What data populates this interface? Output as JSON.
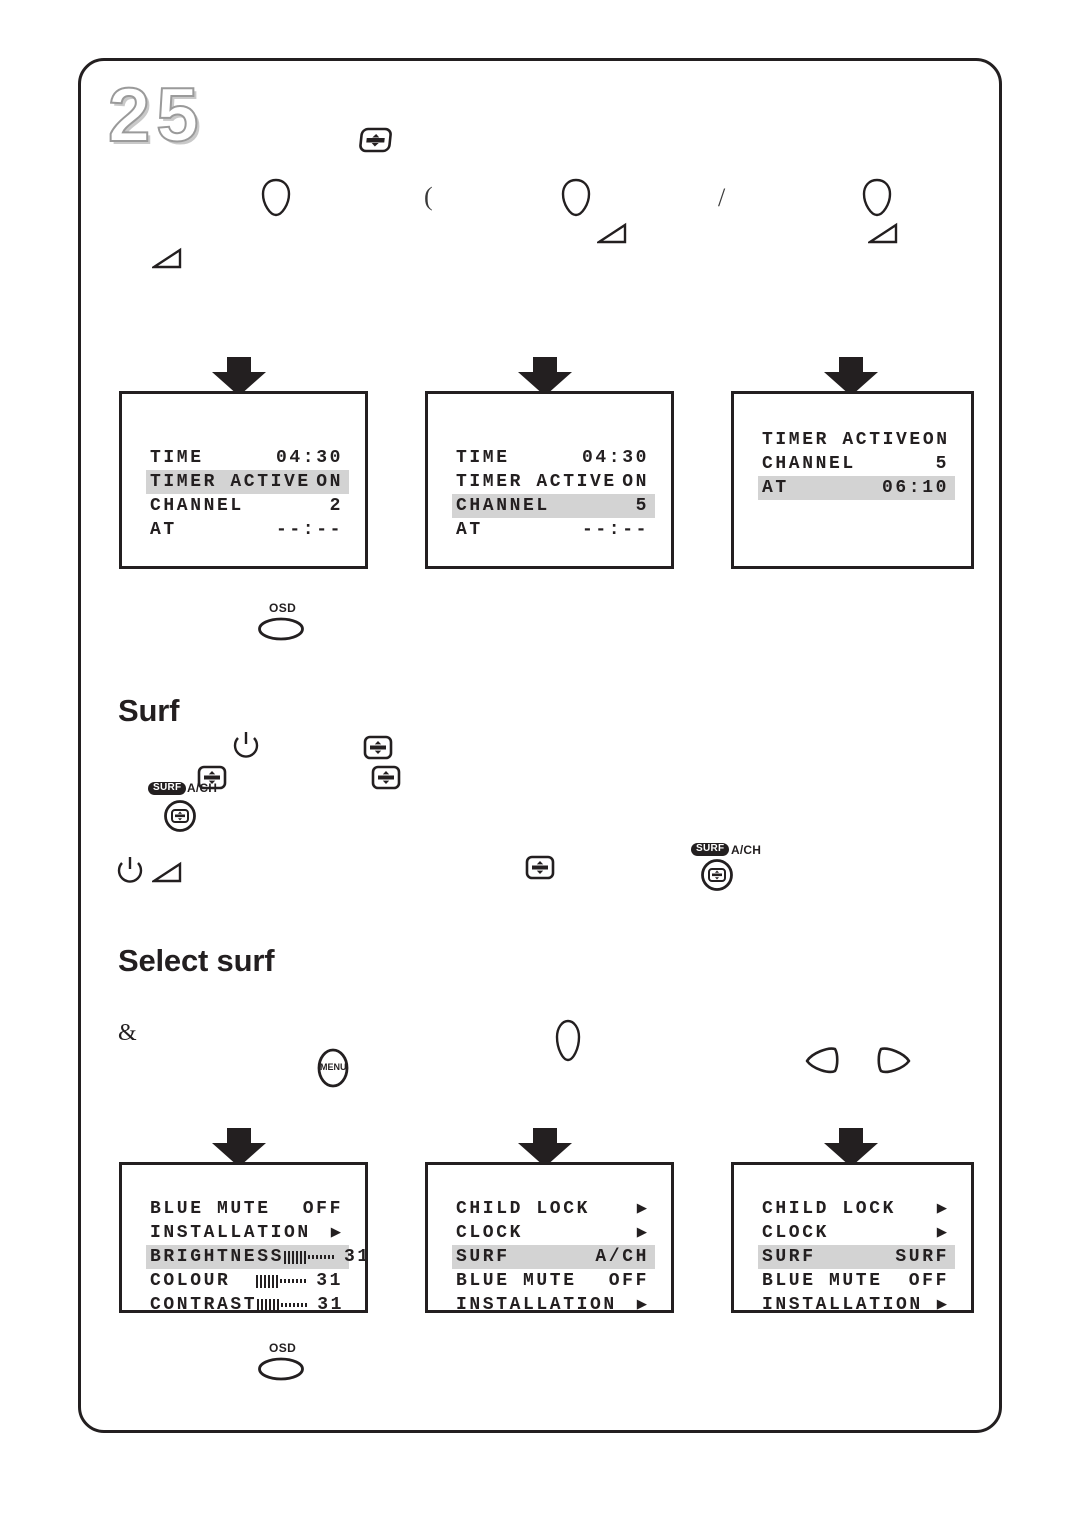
{
  "page": {
    "number": "25",
    "frame_color": "#231f20"
  },
  "headings": {
    "surf": "Surf",
    "select_surf": "Select surf"
  },
  "symbols": {
    "ampersand": "&",
    "slash": "/",
    "paren": "("
  },
  "buttons": {
    "osd_label": "OSD",
    "menu_label": "MENU",
    "surf_badge": "SURF",
    "ach_label": "A/CH"
  },
  "osd_screens": [
    {
      "id": "timer-screen-1",
      "rows": [
        {
          "label": "TIME",
          "value": "04:30",
          "highlight": false,
          "kind": "value"
        },
        {
          "label": "TIMER ACTIVE",
          "value": "ON",
          "highlight": true,
          "kind": "value"
        },
        {
          "label": "CHANNEL",
          "value": "2",
          "highlight": false,
          "kind": "value"
        },
        {
          "label": "AT",
          "value": "--:--",
          "highlight": false,
          "kind": "value"
        }
      ]
    },
    {
      "id": "timer-screen-2",
      "rows": [
        {
          "label": "TIME",
          "value": "04:30",
          "highlight": false,
          "kind": "value"
        },
        {
          "label": "TIMER ACTIVE",
          "value": "ON",
          "highlight": false,
          "kind": "value"
        },
        {
          "label": "CHANNEL",
          "value": "5",
          "highlight": true,
          "kind": "value"
        },
        {
          "label": "AT",
          "value": "--:--",
          "highlight": false,
          "kind": "value"
        }
      ]
    },
    {
      "id": "timer-screen-3",
      "rows": [
        {
          "label": "TIMER ACTIVE",
          "value": "ON",
          "highlight": false,
          "kind": "value"
        },
        {
          "label": "CHANNEL",
          "value": "5",
          "highlight": false,
          "kind": "value"
        },
        {
          "label": "AT",
          "value": "06:10",
          "highlight": true,
          "kind": "value"
        }
      ]
    },
    {
      "id": "picture-menu-screen",
      "rows": [
        {
          "label": "BLUE MUTE",
          "value": "OFF",
          "highlight": false,
          "kind": "value"
        },
        {
          "label": "INSTALLATION",
          "value": "▶",
          "highlight": false,
          "kind": "arrow"
        },
        {
          "label": "BRIGHTNESS",
          "value": "31",
          "highlight": true,
          "kind": "bar",
          "bar_full": 6,
          "bar_empty": 7
        },
        {
          "label": "COLOUR",
          "value": "31",
          "highlight": false,
          "kind": "bar",
          "bar_full": 6,
          "bar_empty": 7
        },
        {
          "label": "CONTRAST",
          "value": "31",
          "highlight": false,
          "kind": "bar",
          "bar_full": 6,
          "bar_empty": 7
        }
      ]
    },
    {
      "id": "main-menu-screen-ach",
      "rows": [
        {
          "label": "CHILD LOCK",
          "value": "▶",
          "highlight": false,
          "kind": "arrow"
        },
        {
          "label": "CLOCK",
          "value": "▶",
          "highlight": false,
          "kind": "arrow"
        },
        {
          "label": "SURF",
          "value": "A/CH",
          "highlight": true,
          "kind": "value"
        },
        {
          "label": "BLUE MUTE",
          "value": "OFF",
          "highlight": false,
          "kind": "value"
        },
        {
          "label": "INSTALLATION",
          "value": "▶",
          "highlight": false,
          "kind": "arrow"
        }
      ]
    },
    {
      "id": "main-menu-screen-surf",
      "rows": [
        {
          "label": "CHILD LOCK",
          "value": "▶",
          "highlight": false,
          "kind": "arrow"
        },
        {
          "label": "CLOCK",
          "value": "▶",
          "highlight": false,
          "kind": "arrow"
        },
        {
          "label": "SURF",
          "value": "SURF",
          "highlight": true,
          "kind": "value"
        },
        {
          "label": "BLUE MUTE",
          "value": "OFF",
          "highlight": false,
          "kind": "value"
        },
        {
          "label": "INSTALLATION",
          "value": "▶",
          "highlight": false,
          "kind": "arrow"
        }
      ]
    }
  ]
}
